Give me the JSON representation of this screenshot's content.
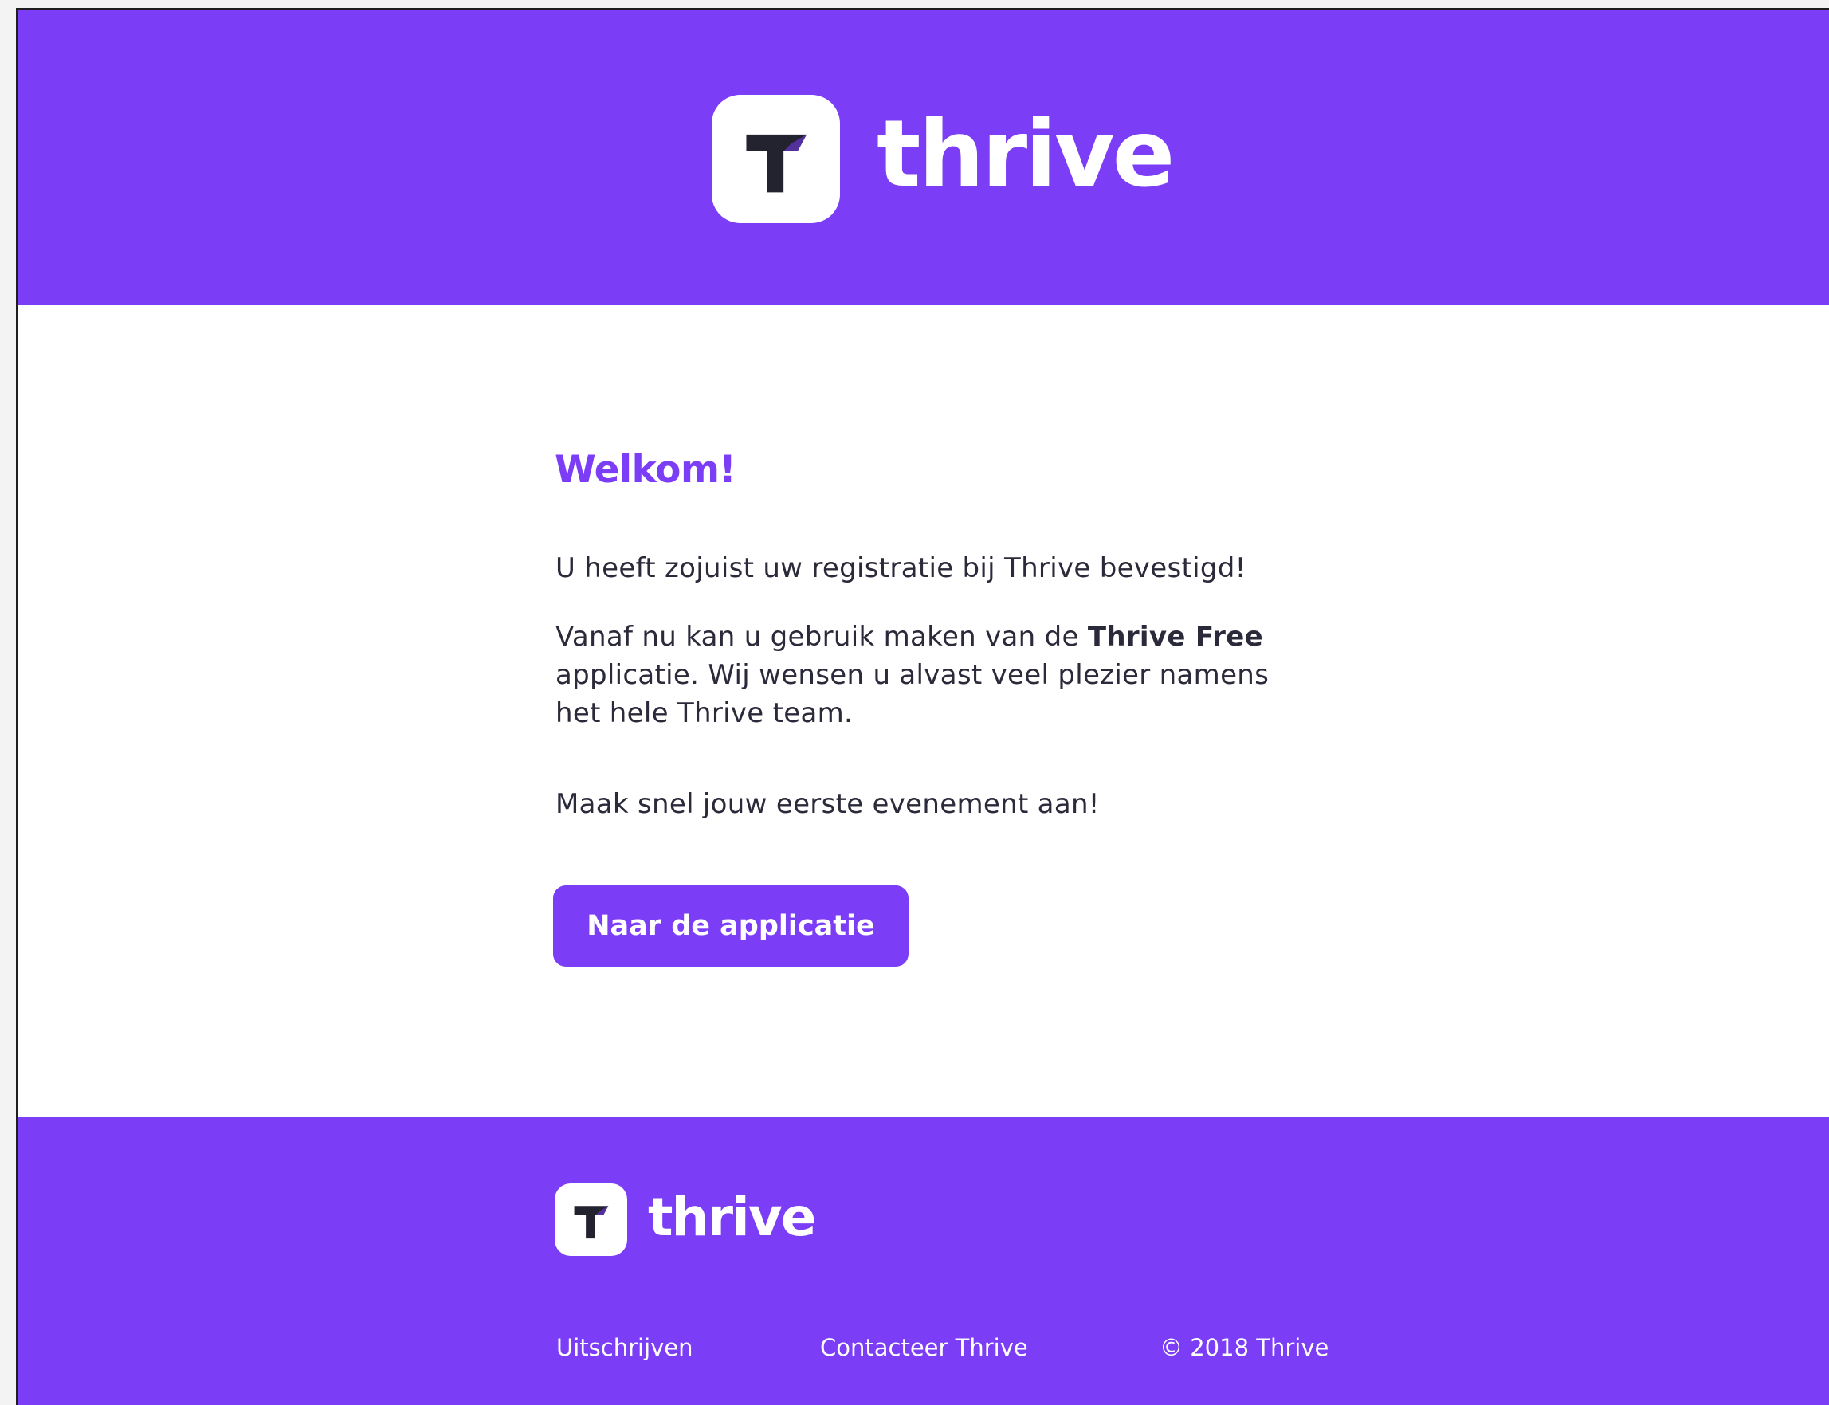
{
  "brand": {
    "name": "thrive",
    "accent_color": "#7b3df5",
    "logo_icon": "thrive-t-logo-icon"
  },
  "main": {
    "headline": "Welkom!",
    "paragraph_1": "U heeft zojuist uw registratie bij Thrive bevestigd!",
    "paragraph_2_before": "Vanaf nu kan u gebruik maken van de ",
    "paragraph_2_bold": "Thrive Free",
    "paragraph_2_after": " applicatie. Wij wensen u alvast veel plezier namens het hele Thrive team.",
    "paragraph_3": "Maak snel jouw eerste evenement aan!",
    "cta_label": "Naar de applicatie"
  },
  "footer": {
    "unsubscribe_label": "Uitschrijven",
    "contact_label": "Contacteer Thrive",
    "copyright": "© 2018 Thrive"
  }
}
